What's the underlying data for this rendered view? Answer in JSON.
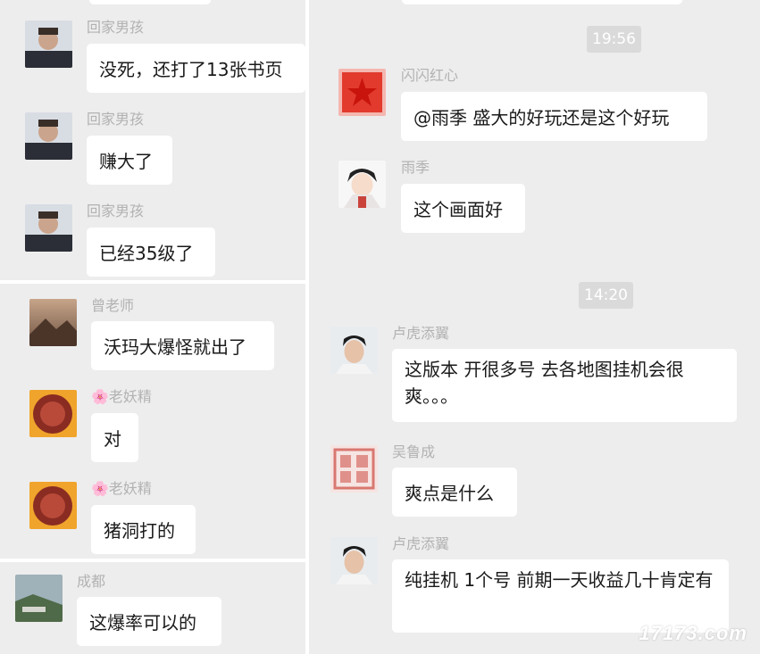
{
  "left_top": {
    "messages": [
      {
        "sender": "回家男孩",
        "text": "没死，还打了13张书页"
      },
      {
        "sender": "回家男孩",
        "text": "赚大了"
      },
      {
        "sender": "回家男孩",
        "text": "已经35级了"
      }
    ]
  },
  "left_mid": {
    "messages": [
      {
        "sender": "曾老师",
        "text": "沃玛大爆怪就出了"
      },
      {
        "sender": "🌸老妖精",
        "text": "对"
      },
      {
        "sender": "🌸老妖精",
        "text": "猪洞打的"
      }
    ]
  },
  "left_bottom": {
    "messages": [
      {
        "sender": "成都",
        "text": "这爆率可以的"
      }
    ]
  },
  "right": {
    "time1": "19:56",
    "time2": "14:20",
    "messages": [
      {
        "sender": "闪闪红心",
        "text": "@雨季 盛大的好玩还是这个好玩"
      },
      {
        "sender": "雨季",
        "text": "这个画面好"
      },
      {
        "sender": "卢虎添翼",
        "text": "这版本  开很多号  去各地图挂机会很爽。。。"
      },
      {
        "sender": "吴鲁成",
        "text": "爽点是什么"
      },
      {
        "sender": "卢虎添翼",
        "text": "纯挂机  1个号  前期一天收益几十肯定有"
      }
    ]
  },
  "watermark": "17173.com",
  "colors": {
    "chat_bg": "#ededed",
    "bubble": "#ffffff",
    "name": "#b2b2b2",
    "time_chip": "#dadada"
  }
}
